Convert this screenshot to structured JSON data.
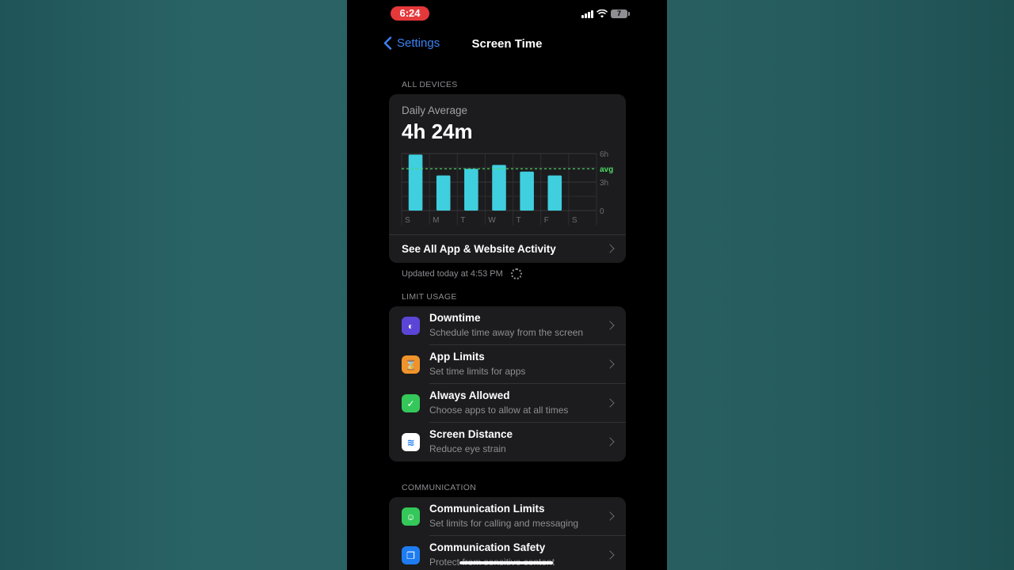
{
  "status_bar": {
    "time": "6:24",
    "battery": "7"
  },
  "nav": {
    "back_label": "Settings",
    "title": "Screen Time"
  },
  "all_devices": {
    "header": "ALL DEVICES",
    "daily_label": "Daily Average",
    "daily_value": "4h 24m",
    "activity_label": "See All App & Website Activity",
    "updated": "Updated today at 4:53 PM"
  },
  "chart_data": {
    "type": "bar",
    "categories": [
      "S",
      "M",
      "T",
      "W",
      "T",
      "F",
      "S"
    ],
    "values": [
      5.9,
      3.7,
      4.4,
      4.8,
      4.1,
      3.7,
      0
    ],
    "avg": 4.4,
    "avg_label": "avg",
    "ylim": [
      0,
      6
    ],
    "y_ticks": [
      0,
      3,
      6
    ],
    "y_tick_labels": [
      "0",
      "3h",
      "6h"
    ],
    "bar_color": "#3fcfde",
    "avg_color": "#4cd964",
    "grid": true
  },
  "limit_usage": {
    "header": "LIMIT USAGE",
    "items": [
      {
        "title": "Downtime",
        "subtitle": "Schedule time away from the screen",
        "icon": "moon-clock-icon",
        "icon_bg": "#5b45d6",
        "glyph": "◐"
      },
      {
        "title": "App Limits",
        "subtitle": "Set time limits for apps",
        "icon": "hourglass-icon",
        "icon_bg": "#f0932b",
        "glyph": "⌛"
      },
      {
        "title": "Always Allowed",
        "subtitle": "Choose apps to allow at all times",
        "icon": "checkmark-shield-icon",
        "icon_bg": "#34c759",
        "glyph": "✓"
      },
      {
        "title": "Screen Distance",
        "subtitle": "Reduce eye strain",
        "icon": "chevrons-up-icon",
        "icon_bg": "#ffffff",
        "glyph": "≋"
      }
    ]
  },
  "communication": {
    "header": "COMMUNICATION",
    "items": [
      {
        "title": "Communication Limits",
        "subtitle": "Set limits for calling and messaging",
        "icon": "person-circle-icon",
        "icon_bg": "#34c759",
        "glyph": "☺"
      },
      {
        "title": "Communication Safety",
        "subtitle": "Protect from sensitive content",
        "icon": "chat-bubbles-icon",
        "icon_bg": "#1e7cf2",
        "glyph": "❐"
      }
    ]
  }
}
